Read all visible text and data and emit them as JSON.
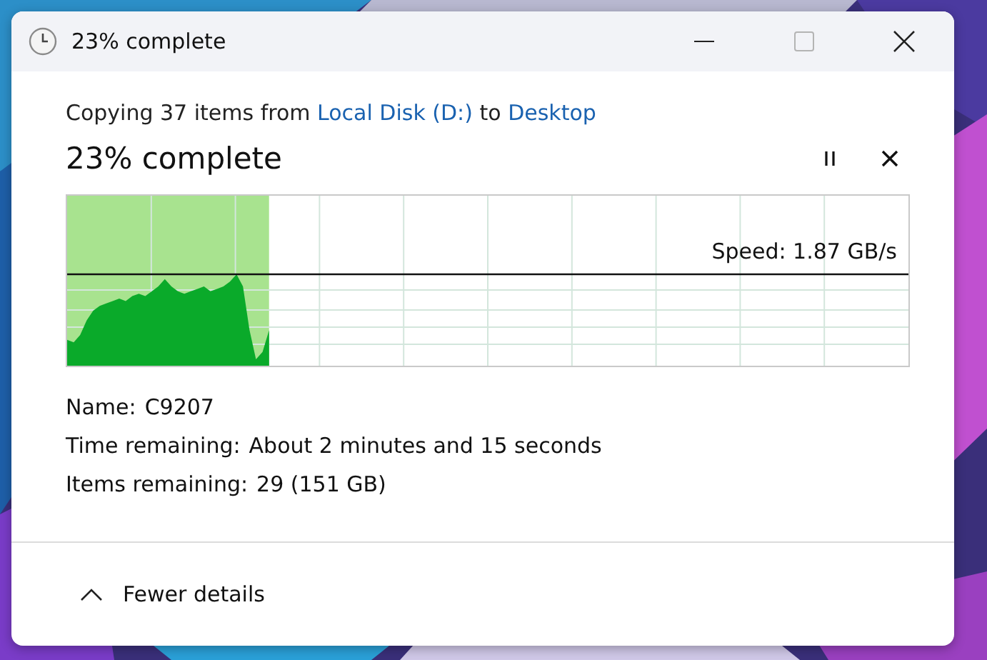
{
  "window": {
    "title": "23% complete"
  },
  "message": {
    "prefix": "Copying 37 items from",
    "source": "Local Disk (D:)",
    "middle": "to",
    "destination": "Desktop"
  },
  "heading": "23% complete",
  "progress": {
    "level": 0.24,
    "speed": "Speed: 1.87 GB/s"
  },
  "details": [
    {
      "label": "Name:",
      "value": "C9207"
    },
    {
      "label": "Time remaining:",
      "value": "About 2 minutes and 15 seconds"
    },
    {
      "label": "Items remaining:",
      "value": "29 (151 GB)"
    }
  ],
  "footer": {
    "label": "Fewer details",
    "expanded": true
  }
}
